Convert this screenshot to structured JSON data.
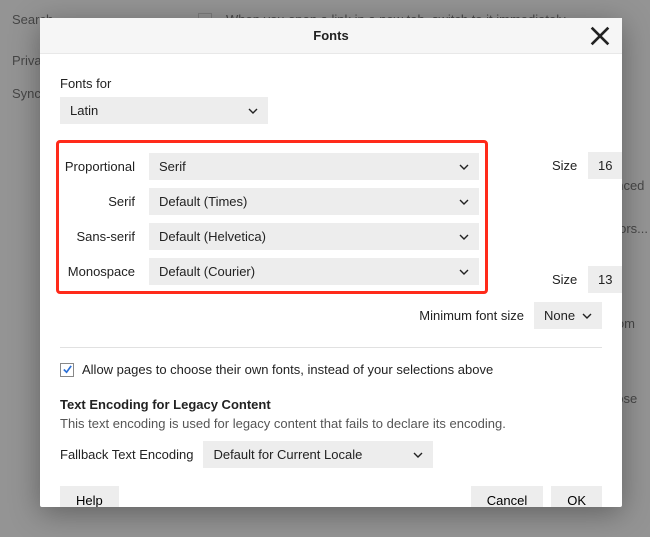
{
  "background": {
    "searchLabel": "Search",
    "privacyLabel": "Privacy",
    "syncLabel": "Sync",
    "checkboxText": "When you open a link in a new tab, switch to it immediately",
    "rightItems": [
      "anced",
      "olors...",
      "from",
      "oose"
    ]
  },
  "modal": {
    "title": "Fonts",
    "fontsForLabel": "Fonts for",
    "fontsForValue": "Latin",
    "rows": {
      "proportional": {
        "label": "Proportional",
        "value": "Serif",
        "sizeLabel": "Size",
        "sizeValue": "16"
      },
      "serif": {
        "label": "Serif",
        "value": "Default (Times)"
      },
      "sansSerif": {
        "label": "Sans-serif",
        "value": "Default (Helvetica)"
      },
      "monospace": {
        "label": "Monospace",
        "value": "Default (Courier)",
        "sizeLabel": "Size",
        "sizeValue": "13"
      }
    },
    "minFontLabel": "Minimum font size",
    "minFontValue": "None",
    "allowPagesLabel": "Allow pages to choose their own fonts, instead of your selections above",
    "encoding": {
      "heading": "Text Encoding for Legacy Content",
      "desc": "This text encoding is used for legacy content that fails to declare its encoding.",
      "fallbackLabel": "Fallback Text Encoding",
      "fallbackValue": "Default for Current Locale"
    },
    "buttons": {
      "help": "Help",
      "cancel": "Cancel",
      "ok": "OK"
    }
  }
}
